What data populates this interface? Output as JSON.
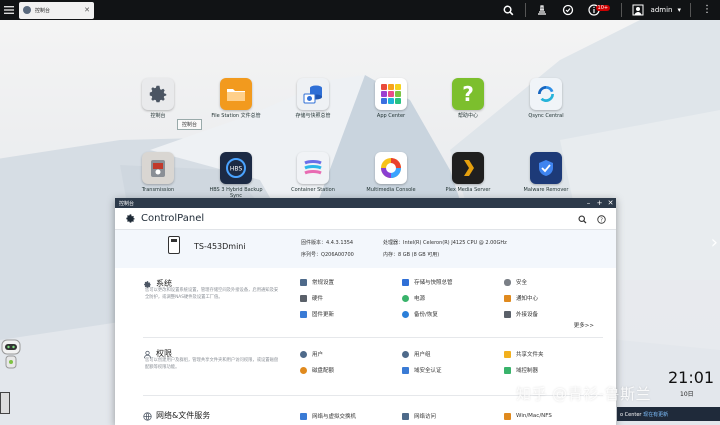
{
  "topbar": {
    "tab_label": "控制台",
    "info_badge": "10+",
    "user": "admin"
  },
  "desktop": {
    "tooltip": "控制台",
    "apps": [
      {
        "id": "control-panel",
        "label": "控制台",
        "icon": "gear-icon",
        "color": "#e9eaec"
      },
      {
        "id": "file-station",
        "label": "File Station 文件总管",
        "icon": "folder-icon",
        "color": "#f29a1e"
      },
      {
        "id": "storage",
        "label": "存储与快照总管",
        "icon": "storage-icon",
        "color": "#eef1f4"
      },
      {
        "id": "app-center",
        "label": "App Center",
        "icon": "grid-icon",
        "color": "#ffffff"
      },
      {
        "id": "help",
        "label": "帮助中心",
        "icon": "question-icon",
        "color": "#7cbf2d"
      },
      {
        "id": "qsync",
        "label": "Qsync Central",
        "icon": "sync-icon",
        "color": "#f0f4f8"
      },
      {
        "id": "transmission",
        "label": "Transmission",
        "icon": "transmission-icon",
        "color": "#d9d6d2"
      },
      {
        "id": "hbs",
        "label": "HBS 3 Hybrid Backup Sync",
        "icon": "hbs-icon",
        "color": "#1c2a44"
      },
      {
        "id": "container",
        "label": "Container Station",
        "icon": "container-icon",
        "color": "#f1f3f6"
      },
      {
        "id": "multimedia",
        "label": "Multimedia Console",
        "icon": "multimedia-icon",
        "color": "#ffffff"
      },
      {
        "id": "plex",
        "label": "Plex Media Server",
        "icon": "plex-icon",
        "color": "#1f1f1f"
      },
      {
        "id": "malware",
        "label": "Malware Remover",
        "icon": "shield-icon",
        "color": "#1d3a78"
      }
    ],
    "clock": "21:01",
    "clock_date": "10日",
    "watermark": "知乎 @青衫-鲁斯兰",
    "notify_text": "o Center",
    "notify_link": "现在有更新"
  },
  "window": {
    "title": "控制台",
    "brand_a": "Control",
    "brand_b": "Panel",
    "device": {
      "name": "TS-453Dmini",
      "firmware_label": "固件版本：",
      "firmware": "4.4.3.1354",
      "serial_label": "序列号：",
      "serial": "Q206A00700",
      "cpu_label": "处理器：",
      "cpu": "Intel(R) Celeron(R) J4125 CPU @ 2.00GHz",
      "memory_label": "内存：",
      "memory": "8 GB (8 GB 可用)"
    },
    "sections": [
      {
        "title": "系统",
        "icon": "gear-icon",
        "desc": "您可以更改和设置系统设置，管理存储空间及外接设备，启用通知及安全防护，或调整NAS硬件及设置工厂值。",
        "items": [
          "常规设置",
          "存储与快照总管",
          "安全",
          "硬件",
          "电源",
          "通知中心",
          "固件更新",
          "备份/恢复",
          "外接设备"
        ],
        "more": "更多>>"
      },
      {
        "title": "权限",
        "icon": "user-shield-icon",
        "desc": "您可以创建用户及群组，管理共享文件夹和用户访问权限，或设置磁盘配额等权限功能。",
        "items": [
          "用户",
          "用户组",
          "共享文件夹",
          "磁盘配额",
          "域安全认证",
          "域控制器"
        ],
        "more": ""
      },
      {
        "title": "网络&文件服务",
        "icon": "globe-icon",
        "desc": "",
        "items": [
          "网络与虚拟交换机",
          "网络访问",
          "Win/Mac/NFS"
        ],
        "more": ""
      }
    ]
  },
  "colors": {
    "topbar_bg": "#111315",
    "window_titlebar": "#2d3a4a",
    "accent_blue": "#3a7bd5"
  }
}
